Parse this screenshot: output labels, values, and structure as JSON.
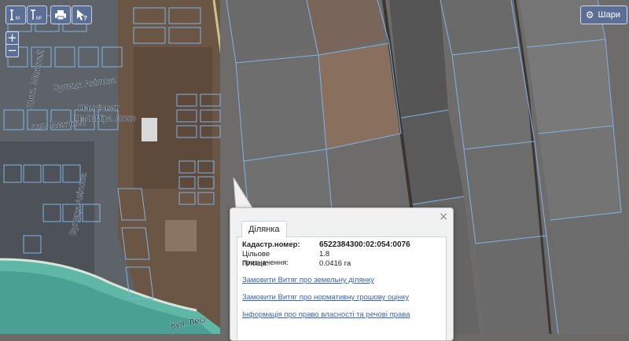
{
  "toolbar": {
    "measure_length": {
      "icon": "measure-length-icon",
      "label": "M"
    },
    "measure_area": {
      "icon": "measure-area-icon",
      "label": "M²"
    },
    "print": {
      "icon": "print-icon"
    },
    "info": {
      "icon": "cursor-help-icon"
    }
  },
  "zoom": {
    "in_label": "+",
    "out_label": "−"
  },
  "layers": {
    "icon": "gear-icon",
    "label": "Шари"
  },
  "map_labels": {
    "street_aviv": "Вулиця Авілова",
    "pansion": "Пансіонат",
    "palmira": "Пальміра Люкс",
    "per_mayachnyi": "пров. Маячний",
    "per_mayachnyi_2": "пер. Маячний",
    "street_vertical": "Вулиця Авілова",
    "s_jugal": "вул. Лесі"
  },
  "popup": {
    "close": "×",
    "tab": "Ділянка",
    "fields": [
      {
        "label": "Кадастр.номер:",
        "value": "6522384300:02:054:0076"
      },
      {
        "label": "Цільове призначення:",
        "value": "1.8"
      },
      {
        "label": "Площа:",
        "value": "0.0416 га"
      }
    ],
    "links": [
      "Замовити Витяг про земельну ділянку",
      "Замовити Витяг про нормативну грошову оцінку",
      "Інформація про право власності та речові права"
    ]
  },
  "colors": {
    "parcel_line": "#7fb3e6",
    "control_bg": "#5b6f96",
    "link": "#3a64b4",
    "sea": "#5fb7a6"
  }
}
